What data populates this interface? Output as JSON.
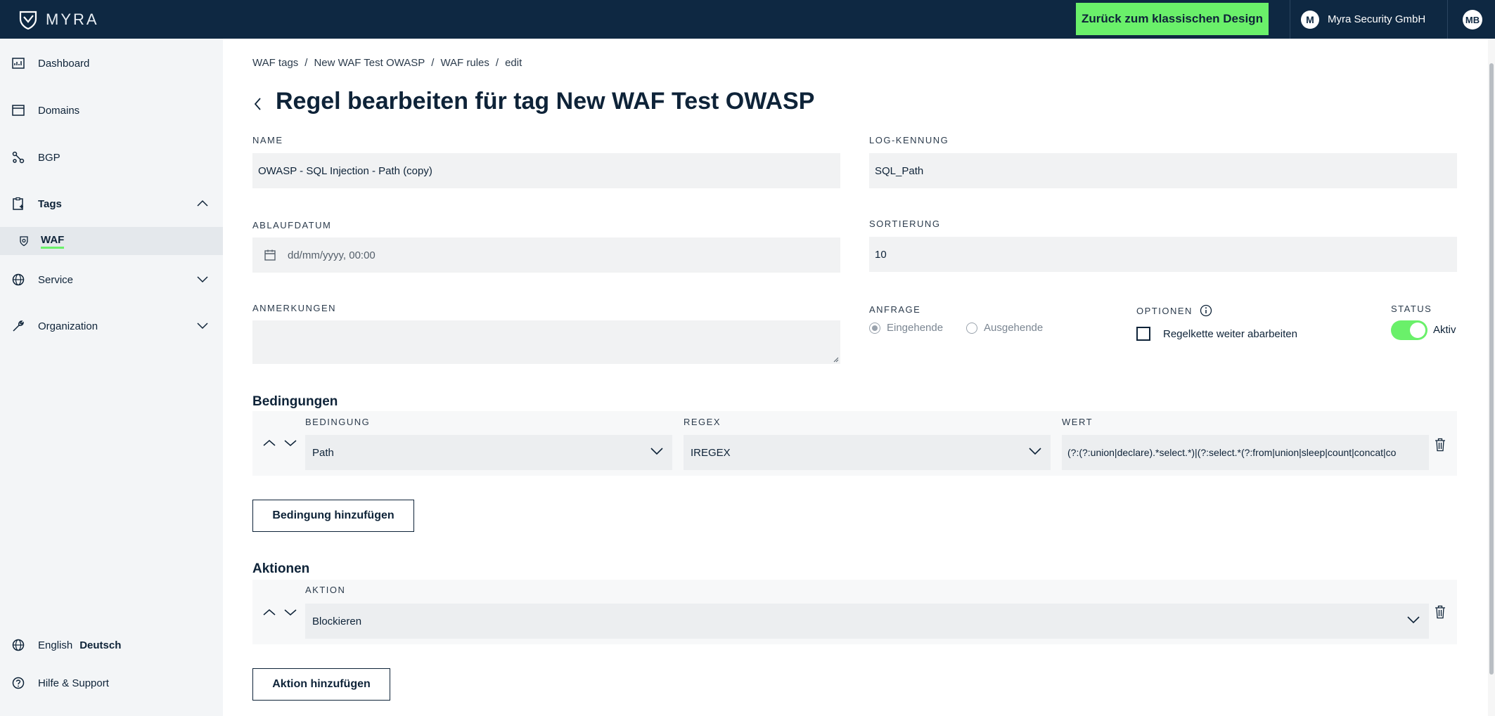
{
  "header": {
    "brand": "MYRA",
    "classic_button": "Zurück zum klassischen Design",
    "org_initial": "M",
    "org_name": "Myra Security GmbH",
    "user_initials": "MB"
  },
  "sidebar": {
    "items": [
      {
        "label": "Dashboard",
        "icon": "dashboard-icon"
      },
      {
        "label": "Domains",
        "icon": "window-icon"
      },
      {
        "label": "BGP",
        "icon": "network-icon"
      },
      {
        "label": "Tags",
        "icon": "tag-clipboard-icon"
      },
      {
        "label": "Service",
        "icon": "globe-icon"
      },
      {
        "label": "Organization",
        "icon": "wrench-icon"
      }
    ],
    "sub_item": "WAF",
    "lang_en": "English",
    "lang_de": "Deutsch",
    "help": "Hilfe & Support"
  },
  "breadcrumb": [
    "WAF tags",
    "New WAF Test OWASP",
    "WAF rules",
    "edit"
  ],
  "page_title": "Regel bearbeiten für tag New WAF Test OWASP",
  "form": {
    "name_label": "NAME",
    "name_value": "OWASP - SQL Injection - Path (copy)",
    "log_label": "LOG-KENNUNG",
    "log_value": "SQL_Path",
    "expiry_label": "ABLAUFDATUM",
    "expiry_placeholder": "dd/mm/yyyy, 00:00",
    "sort_label": "SORTIERUNG",
    "sort_value": "10",
    "notes_label": "ANMERKUNGEN",
    "request_label": "ANFRAGE",
    "request_in": "Eingehende",
    "request_out": "Ausgehende",
    "options_label": "OPTIONEN",
    "options_checkbox": "Regelkette weiter abarbeiten",
    "status_label": "STATUS",
    "status_value": "Aktiv"
  },
  "conditions": {
    "title": "Bedingungen",
    "col_condition": "BEDINGUNG",
    "col_regex": "REGEX",
    "col_value": "WERT",
    "condition": "Path",
    "regex": "IREGEX",
    "value": "(?:(?:union|declare).*select.*)|(?:select.*(?:from|union|sleep|count|concat|co",
    "add_button": "Bedingung hinzufügen"
  },
  "actions": {
    "title": "Aktionen",
    "col_action": "AKTION",
    "action": "Blockieren",
    "add_button": "Aktion hinzufügen"
  },
  "colors": {
    "navy": "#0e2842",
    "accent_green": "#6af06a",
    "sidebar_bg": "#f3f5f7"
  }
}
